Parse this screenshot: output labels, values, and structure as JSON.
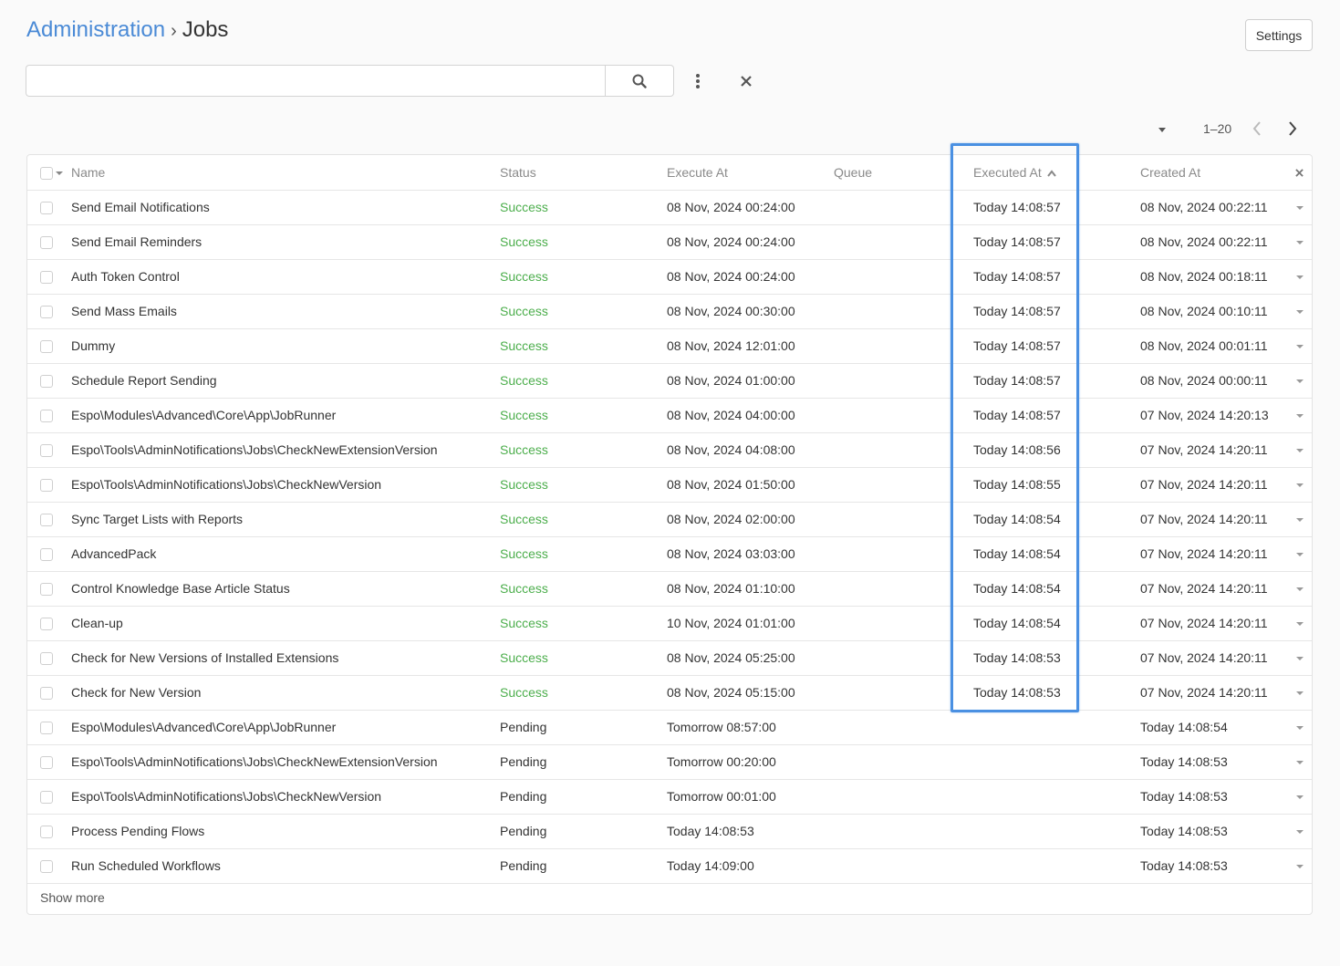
{
  "breadcrumb": {
    "parent": "Administration",
    "separator": "›",
    "current": "Jobs"
  },
  "settings_label": "Settings",
  "search": {
    "placeholder": "",
    "value": ""
  },
  "pagination": {
    "range": "1–20"
  },
  "table": {
    "headers": {
      "name": "Name",
      "status": "Status",
      "execute_at": "Execute At",
      "queue": "Queue",
      "executed_at": "Executed At",
      "created_at": "Created At"
    },
    "sorted_by": "executed_at",
    "rows": [
      {
        "name": "Send Email Notifications",
        "status": "Success",
        "execute_at": "08 Nov, 2024 00:24:00",
        "queue": "",
        "executed_at": "Today 14:08:57",
        "created_at": "08 Nov, 2024 00:22:11"
      },
      {
        "name": "Send Email Reminders",
        "status": "Success",
        "execute_at": "08 Nov, 2024 00:24:00",
        "queue": "",
        "executed_at": "Today 14:08:57",
        "created_at": "08 Nov, 2024 00:22:11"
      },
      {
        "name": "Auth Token Control",
        "status": "Success",
        "execute_at": "08 Nov, 2024 00:24:00",
        "queue": "",
        "executed_at": "Today 14:08:57",
        "created_at": "08 Nov, 2024 00:18:11"
      },
      {
        "name": "Send Mass Emails",
        "status": "Success",
        "execute_at": "08 Nov, 2024 00:30:00",
        "queue": "",
        "executed_at": "Today 14:08:57",
        "created_at": "08 Nov, 2024 00:10:11"
      },
      {
        "name": "Dummy",
        "status": "Success",
        "execute_at": "08 Nov, 2024 12:01:00",
        "queue": "",
        "executed_at": "Today 14:08:57",
        "created_at": "08 Nov, 2024 00:01:11"
      },
      {
        "name": "Schedule Report Sending",
        "status": "Success",
        "execute_at": "08 Nov, 2024 01:00:00",
        "queue": "",
        "executed_at": "Today 14:08:57",
        "created_at": "08 Nov, 2024 00:00:11"
      },
      {
        "name": "Espo\\Modules\\Advanced\\Core\\App\\JobRunner",
        "status": "Success",
        "execute_at": "08 Nov, 2024 04:00:00",
        "queue": "",
        "executed_at": "Today 14:08:57",
        "created_at": "07 Nov, 2024 14:20:13"
      },
      {
        "name": "Espo\\Tools\\AdminNotifications\\Jobs\\CheckNewExtensionVersion",
        "status": "Success",
        "execute_at": "08 Nov, 2024 04:08:00",
        "queue": "",
        "executed_at": "Today 14:08:56",
        "created_at": "07 Nov, 2024 14:20:11"
      },
      {
        "name": "Espo\\Tools\\AdminNotifications\\Jobs\\CheckNewVersion",
        "status": "Success",
        "execute_at": "08 Nov, 2024 01:50:00",
        "queue": "",
        "executed_at": "Today 14:08:55",
        "created_at": "07 Nov, 2024 14:20:11"
      },
      {
        "name": "Sync Target Lists with Reports",
        "status": "Success",
        "execute_at": "08 Nov, 2024 02:00:00",
        "queue": "",
        "executed_at": "Today 14:08:54",
        "created_at": "07 Nov, 2024 14:20:11"
      },
      {
        "name": "AdvancedPack",
        "status": "Success",
        "execute_at": "08 Nov, 2024 03:03:00",
        "queue": "",
        "executed_at": "Today 14:08:54",
        "created_at": "07 Nov, 2024 14:20:11"
      },
      {
        "name": "Control Knowledge Base Article Status",
        "status": "Success",
        "execute_at": "08 Nov, 2024 01:10:00",
        "queue": "",
        "executed_at": "Today 14:08:54",
        "created_at": "07 Nov, 2024 14:20:11"
      },
      {
        "name": "Clean-up",
        "status": "Success",
        "execute_at": "10 Nov, 2024 01:01:00",
        "queue": "",
        "executed_at": "Today 14:08:54",
        "created_at": "07 Nov, 2024 14:20:11"
      },
      {
        "name": "Check for New Versions of Installed Extensions",
        "status": "Success",
        "execute_at": "08 Nov, 2024 05:25:00",
        "queue": "",
        "executed_at": "Today 14:08:53",
        "created_at": "07 Nov, 2024 14:20:11"
      },
      {
        "name": "Check for New Version",
        "status": "Success",
        "execute_at": "08 Nov, 2024 05:15:00",
        "queue": "",
        "executed_at": "Today 14:08:53",
        "created_at": "07 Nov, 2024 14:20:11"
      },
      {
        "name": "Espo\\Modules\\Advanced\\Core\\App\\JobRunner",
        "status": "Pending",
        "execute_at": "Tomorrow 08:57:00",
        "queue": "",
        "executed_at": "",
        "created_at": "Today 14:08:54"
      },
      {
        "name": "Espo\\Tools\\AdminNotifications\\Jobs\\CheckNewExtensionVersion",
        "status": "Pending",
        "execute_at": "Tomorrow 00:20:00",
        "queue": "",
        "executed_at": "",
        "created_at": "Today 14:08:53"
      },
      {
        "name": "Espo\\Tools\\AdminNotifications\\Jobs\\CheckNewVersion",
        "status": "Pending",
        "execute_at": "Tomorrow 00:01:00",
        "queue": "",
        "executed_at": "",
        "created_at": "Today 14:08:53"
      },
      {
        "name": "Process Pending Flows",
        "status": "Pending",
        "execute_at": "Today 14:08:53",
        "queue": "",
        "executed_at": "",
        "created_at": "Today 14:08:53"
      },
      {
        "name": "Run Scheduled Workflows",
        "status": "Pending",
        "execute_at": "Today 14:09:00",
        "queue": "",
        "executed_at": "",
        "created_at": "Today 14:08:53"
      }
    ]
  },
  "show_more_label": "Show more",
  "colors": {
    "link": "#4a8ad6",
    "success": "#4cae4c",
    "highlight": "#4a90e2"
  },
  "icons": [
    "search-icon",
    "kebab-menu-icon",
    "close-icon",
    "caret-down-icon",
    "chevron-left-icon",
    "chevron-right-icon",
    "sort-ascending-icon"
  ]
}
